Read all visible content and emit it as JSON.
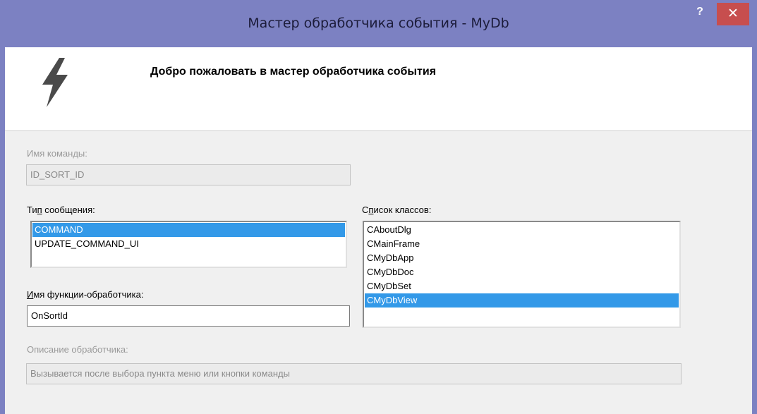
{
  "window": {
    "title": "Мастер обработчика события - MyDb",
    "help_label": "?",
    "close_label": "✕"
  },
  "header": {
    "welcome": "Добро пожаловать в мастер обработчика события",
    "icon": "lightning-bolt-icon"
  },
  "command": {
    "label": "Имя команды:",
    "value": "ID_SORT_ID"
  },
  "message_type": {
    "label_pre": "Ти",
    "label_underlined": "п",
    "label_post": " сообщения:",
    "items": [
      "COMMAND",
      "UPDATE_COMMAND_UI"
    ],
    "selected": "COMMAND"
  },
  "class_list": {
    "label_pre": "С",
    "label_underlined": "п",
    "label_post": "исок классов:",
    "items": [
      "CAboutDlg",
      "CMainFrame",
      "CMyDbApp",
      "CMyDbDoc",
      "CMyDbSet",
      "CMyDbView"
    ],
    "selected": "CMyDbView"
  },
  "handler": {
    "label_underlined": "И",
    "label_post": "мя функции-обработчика:",
    "value": "OnSortId"
  },
  "description": {
    "label": "Описание обработчика:",
    "value": "Вызывается после выбора пункта меню или кнопки команды"
  },
  "colors": {
    "title_bar": "#7c81c2",
    "close_button": "#c74e4e",
    "selection": "#3399e8"
  }
}
